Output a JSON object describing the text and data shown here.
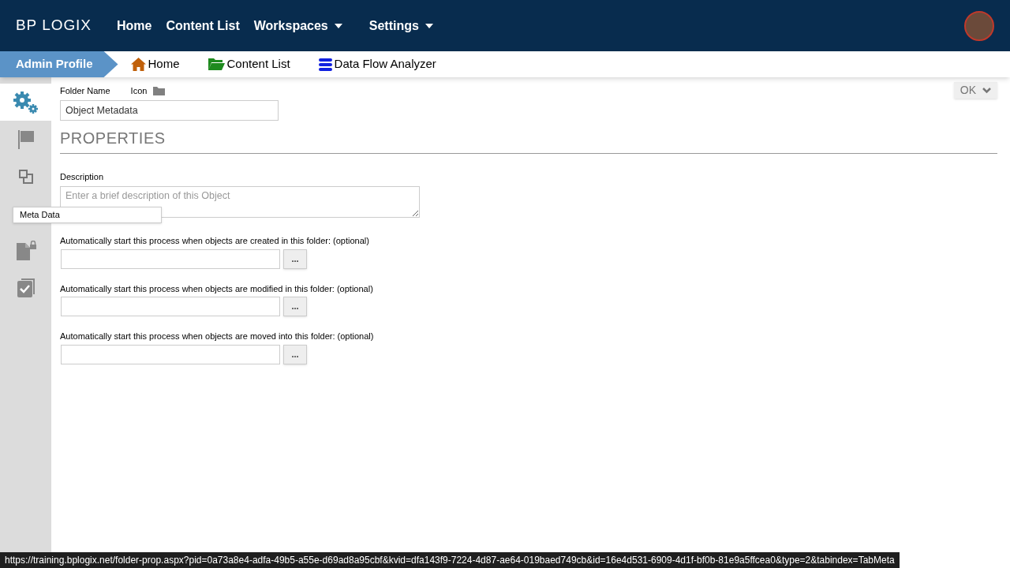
{
  "header": {
    "logo": "BP LOGIX",
    "nav": [
      {
        "label": "Home",
        "dropdown": false
      },
      {
        "label": "Content List",
        "dropdown": false
      },
      {
        "label": "Workspaces",
        "dropdown": true
      },
      {
        "label": "Settings",
        "dropdown": true
      }
    ]
  },
  "breadcrumb": {
    "profile": "Admin Profile",
    "links": [
      {
        "label": "Home",
        "kind": "home"
      },
      {
        "label": "Content List",
        "kind": "folder"
      },
      {
        "label": "Data Flow Analyzer",
        "kind": "database"
      }
    ]
  },
  "sidebar": {
    "items": [
      {
        "kind": "gears",
        "selected": true
      },
      {
        "kind": "flag",
        "selected": false
      },
      {
        "kind": "squares",
        "selected": false
      },
      {
        "kind": "filelock",
        "selected": false
      },
      {
        "kind": "check",
        "selected": false
      }
    ],
    "tooltip": "Meta Data"
  },
  "form": {
    "ok_button": "OK",
    "folder_name_label": "Folder Name",
    "icon_label": "Icon",
    "folder_name": "Object Metadata",
    "section": "PROPERTIES",
    "description_label": "Description",
    "description_placeholder": "Enter a brief description of this Object",
    "processes": [
      {
        "label": "Automatically start this process when objects are created in this folder: (optional)",
        "button": "..."
      },
      {
        "label": "Automatically start this process when objects are modified in this folder: (optional)",
        "button": "..."
      },
      {
        "label": "Automatically start this process when objects are moved into this folder: (optional)",
        "button": "..."
      }
    ]
  },
  "status_bar": {
    "url": "https://training.bplogix.net/folder-prop.aspx?pid=0a73a8e4-adfa-49b5-a55e-d69ad8a95cbf&kvid=dfa143f9-7224-4d87-ae64-019baed749cb&id=16e4d531-6909-4d1f-bf0b-81e9a5ffcea0&type=2&tabindex=TabMeta"
  }
}
